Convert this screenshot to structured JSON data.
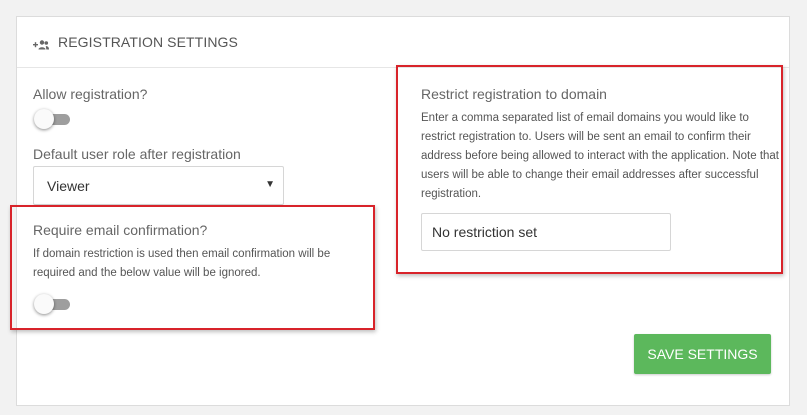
{
  "header": {
    "title": "REGISTRATION SETTINGS",
    "icon": "add-users-icon"
  },
  "allow_registration": {
    "label": "Allow registration?",
    "enabled": false
  },
  "default_role": {
    "label": "Default user role after registration",
    "value": "Viewer",
    "caret": "▼"
  },
  "email_confirmation": {
    "label": "Require email confirmation?",
    "help": "If domain restriction is used then email confirmation will be required and the below value will be ignored.",
    "enabled": false
  },
  "restrict_domain": {
    "label": "Restrict registration to domain",
    "help": "Enter a comma separated list of email domains you would like to restrict registration to. Users will be sent an email to confirm their address before being allowed to interact with the application. Note that users will be able to change their email addresses after successful registration.",
    "value": "No restriction set"
  },
  "actions": {
    "save_label": "SAVE SETTINGS"
  },
  "colors": {
    "primary_button": "#5cb85c",
    "highlight_border": "#d8232a",
    "toggle_off_track": "#9e9e9e"
  }
}
